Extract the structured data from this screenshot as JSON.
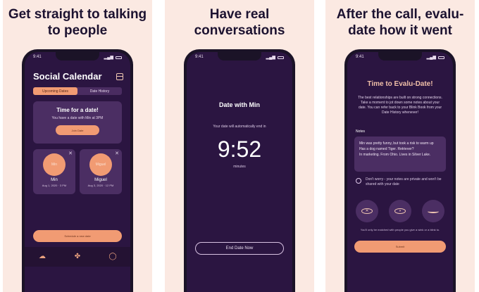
{
  "panels": [
    {
      "headline": "Get straight to talking to people"
    },
    {
      "headline": "Have real conversations"
    },
    {
      "headline": "After the call, evalu-date how it went"
    }
  ],
  "status": {
    "time": "9:41"
  },
  "calendar": {
    "title": "Social Calendar",
    "tabs": [
      "Upcoming Dates",
      "Date History"
    ],
    "date_card": {
      "title": "Time for a date!",
      "text": "You have a date with Min at 3PM",
      "button": "Join Date"
    },
    "people": [
      {
        "avatar": "Min",
        "name": "Min",
        "date": "Aug 1, 2020 · 3 PM"
      },
      {
        "avatar": "Miguel",
        "name": "Miguel",
        "date": "Aug 3, 2020 · 12 PM"
      }
    ],
    "new_button": "Schedule a new date"
  },
  "call": {
    "title": "Date with Min",
    "note": "Your date will automatically end in",
    "timer": "9:52",
    "unit": "minutes",
    "button": "End Date Now"
  },
  "evaludate": {
    "title": "Time to Evalu-Date!",
    "intro": "The best relationships are built on strong connections. Take a moment to jot down some notes about your date. You can refer back to your Blink Book from your Date History whenever!",
    "notes_label": "Notes",
    "notes": [
      "Min was pretty funny, but took a risk to warm up",
      "Has a dog named Tiger. Retriever?",
      "In marketing. From Ohio. Lives in Silver Lake."
    ],
    "privacy": "Don't worry - your notes are private and won't be shared with your date",
    "choice_icons": [
      "open-eye",
      "half-eye",
      "wink"
    ],
    "footnote": "You'll only be matched with people you give a wink or a blink to.",
    "button": "Submit"
  },
  "colors": {
    "accent": "#f19b73",
    "screen": "#2b1541",
    "card": "#4b2e63",
    "backdrop": "#fbe9e2"
  }
}
